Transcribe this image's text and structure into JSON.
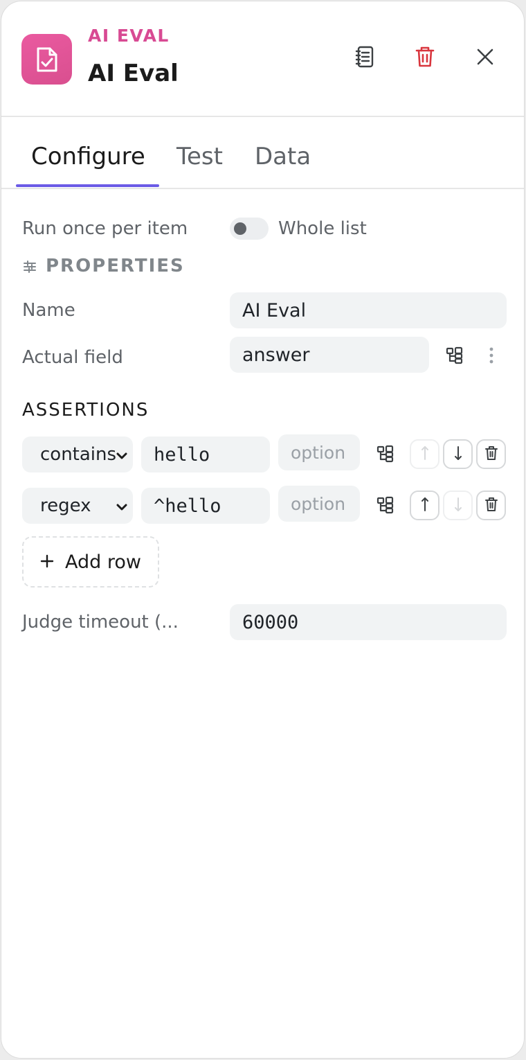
{
  "header": {
    "eyebrow": "AI EVAL",
    "title": "AI Eval",
    "accent_color": "#d84a93"
  },
  "tabs": [
    {
      "label": "Configure",
      "active": true
    },
    {
      "label": "Test",
      "active": false
    },
    {
      "label": "Data",
      "active": false
    }
  ],
  "run_mode": {
    "label": "Run once per item",
    "toggle_label": "Whole list",
    "toggle_on": false
  },
  "properties": {
    "heading": "PROPERTIES",
    "name_label": "Name",
    "name_value": "AI Eval",
    "actual_label": "Actual field",
    "actual_value": "answer"
  },
  "assertions": {
    "heading": "ASSERTIONS",
    "rows": [
      {
        "type": "contains",
        "value": "hello",
        "option_placeholder": "option"
      },
      {
        "type": "regex",
        "value": "^hello",
        "option_placeholder": "option"
      }
    ],
    "add_row_label": "Add row"
  },
  "judge_timeout": {
    "label": "Judge timeout (...",
    "value": "60000"
  }
}
